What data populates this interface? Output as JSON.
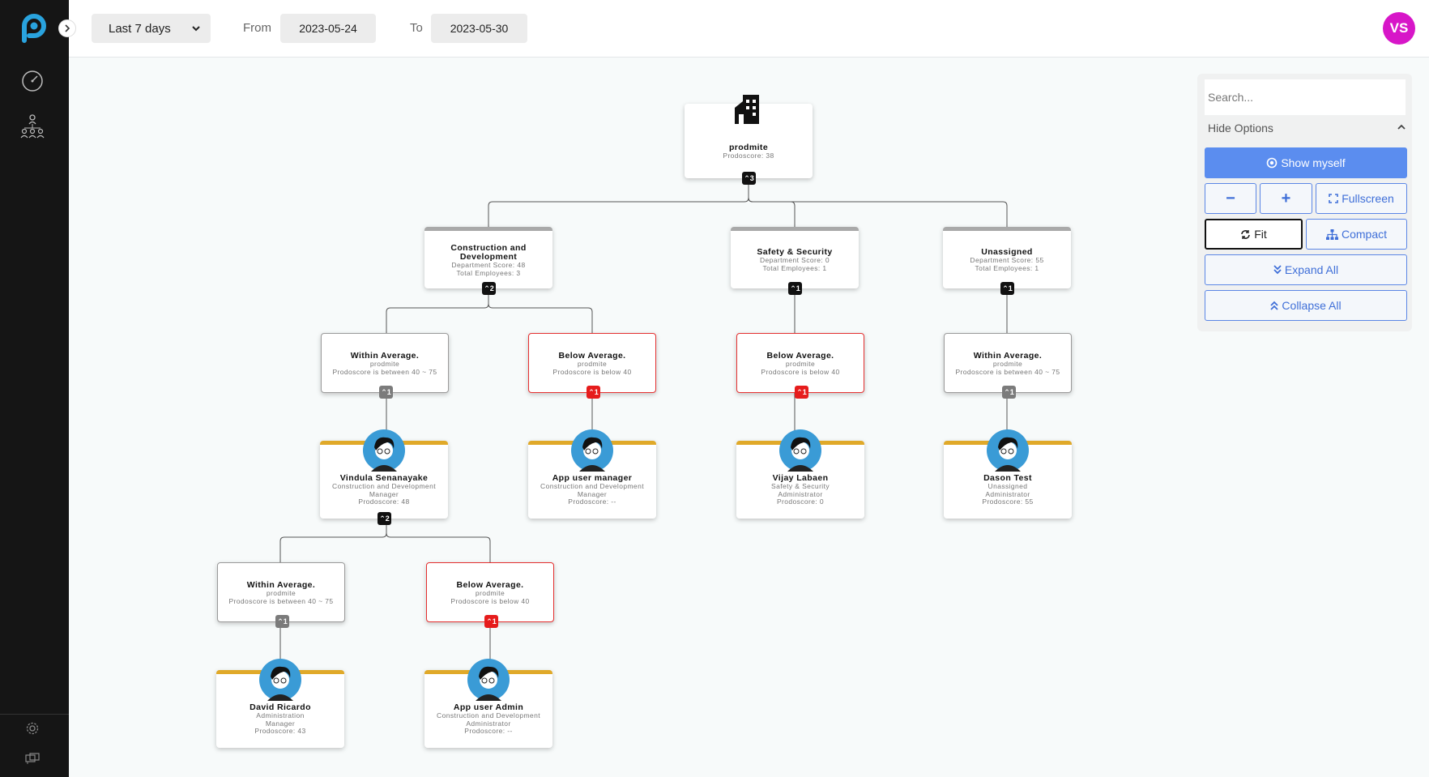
{
  "toolbar": {
    "range": "Last 7 days",
    "from_label": "From",
    "from_date": "2023-05-24",
    "to_label": "To",
    "to_date": "2023-05-30",
    "user_initials": "VS"
  },
  "colors": {
    "accent": "#5b8def",
    "avatar": "#d716c8",
    "below": "#e53030",
    "person_bar": "#e0a929"
  },
  "panel": {
    "search_placeholder": "Search...",
    "hide_options": "Hide Options",
    "show_myself": "Show myself",
    "zoom_out": "−",
    "zoom_in": "+",
    "fullscreen": "Fullscreen",
    "fit": "Fit",
    "compact": "Compact",
    "expand_all": "Expand All",
    "collapse_all": "Collapse All"
  },
  "tree": {
    "root": {
      "title": "prodmite",
      "sub": "Prodoscore: 38",
      "badge": "⌃3"
    },
    "depts": [
      {
        "title": "Construction and Development",
        "score": "Department Score: 48",
        "employees": "Total Employees: 3",
        "badge": "⌃2"
      },
      {
        "title": "Safety & Security",
        "score": "Department Score: 0",
        "employees": "Total Employees: 1",
        "badge": "⌃1"
      },
      {
        "title": "Unassigned",
        "score": "Department Score: 55",
        "employees": "Total Employees: 1",
        "badge": "⌃1"
      }
    ],
    "groups": [
      {
        "title": "Within Average.",
        "org": "prodmite",
        "desc": "Prodoscore is between 40 ~ 75",
        "badge": "⌃1"
      },
      {
        "title": "Below Average.",
        "org": "prodmite",
        "desc": "Prodoscore is below 40",
        "badge": "⌃1"
      },
      {
        "title": "Below Average.",
        "org": "prodmite",
        "desc": "Prodoscore is below 40",
        "badge": "⌃1"
      },
      {
        "title": "Within Average.",
        "org": "prodmite",
        "desc": "Prodoscore is between 40 ~ 75",
        "badge": "⌃1"
      },
      {
        "title": "Within Average.",
        "org": "prodmite",
        "desc": "Prodoscore is between 40 ~ 75",
        "badge": "⌃1"
      },
      {
        "title": "Below Average.",
        "org": "prodmite",
        "desc": "Prodoscore is below 40",
        "badge": "⌃1"
      }
    ],
    "people": [
      {
        "name": "Vindula Senanayake",
        "dept": "Construction and Development",
        "role": "Manager",
        "score": "Prodoscore: 48",
        "badge": "⌃2"
      },
      {
        "name": "App user manager",
        "dept": "Construction and Development",
        "role": "Manager",
        "score": "Prodoscore: --"
      },
      {
        "name": "Vijay Labaen",
        "dept": "Safety & Security",
        "role": "Administrator",
        "score": "Prodoscore: 0"
      },
      {
        "name": "Dason Test",
        "dept": "Unassigned",
        "role": "Administrator",
        "score": "Prodoscore: 55"
      },
      {
        "name": "David Ricardo",
        "dept": "Administration",
        "role": "Manager",
        "score": "Prodoscore: 43"
      },
      {
        "name": "App user Admin",
        "dept": "Construction and Development",
        "role": "Administrator",
        "score": "Prodoscore: --"
      }
    ]
  }
}
